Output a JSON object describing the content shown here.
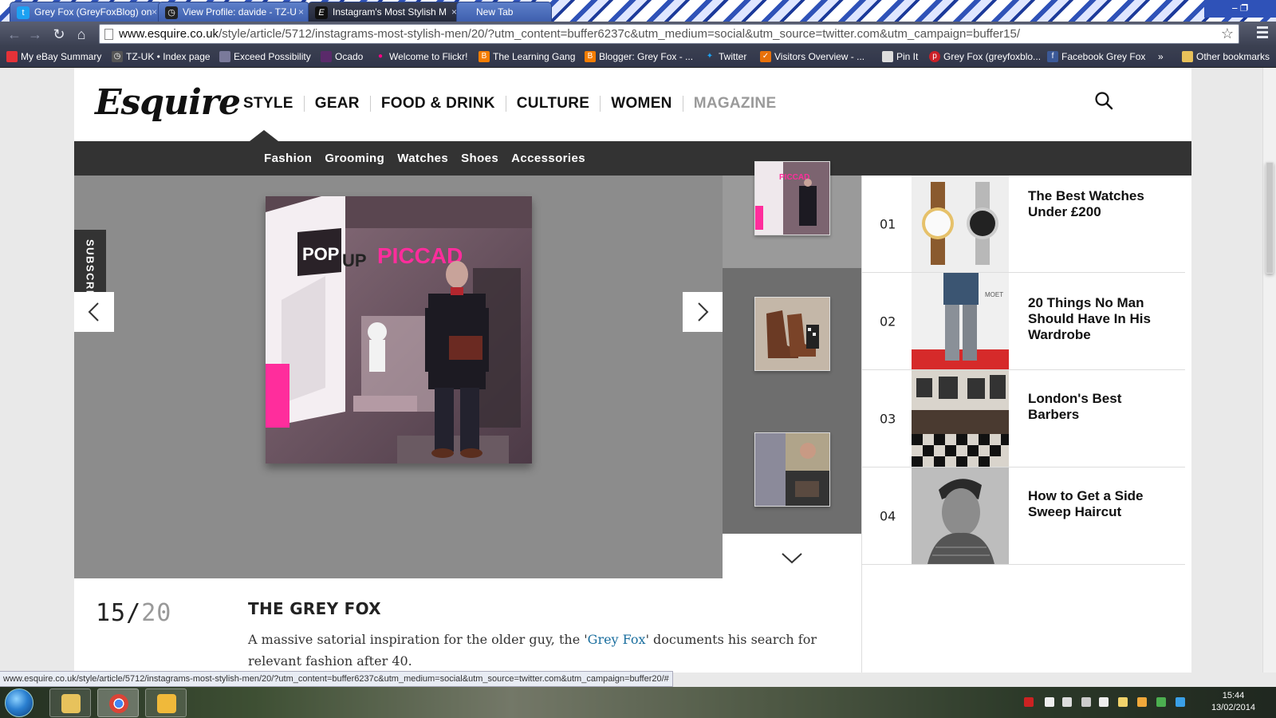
{
  "browser": {
    "tabs": [
      {
        "label": "Grey Fox (GreyFoxBlog) on",
        "icon": "twitter-icon",
        "active": false
      },
      {
        "label": "View Profile: davide - TZ-U",
        "icon": "forum-icon",
        "active": false
      },
      {
        "label": "Instagram's Most Stylish M",
        "icon": "esquire-icon",
        "active": true
      },
      {
        "label": "New Tab",
        "icon": "new-tab-icon",
        "active": false
      }
    ],
    "url_host": "www.esquire.co.uk",
    "url_path": "/style/article/5712/instagrams-most-stylish-men/20/?utm_content=buffer6237c&utm_medium=social&utm_source=twitter.com&utm_campaign=buffer15/",
    "bookmarks": [
      {
        "label": "My eBay Summary",
        "icon": "ebay-icon",
        "color": "#e53238"
      },
      {
        "label": "TZ-UK • Index page",
        "icon": "clock-icon",
        "color": "#555555"
      },
      {
        "label": "Exceed Possibility",
        "icon": "page-icon",
        "color": "#7a7a9a"
      },
      {
        "label": "Ocado",
        "icon": "ocado-icon",
        "color": "#5a2a6a"
      },
      {
        "label": "Welcome to Flickr!",
        "icon": "flickr-icon",
        "color": "#ff0084"
      },
      {
        "label": "The Learning Gang",
        "icon": "blogger-icon",
        "color": "#f57d00"
      },
      {
        "label": "Blogger: Grey Fox - ...",
        "icon": "blogger-icon",
        "color": "#f57d00"
      },
      {
        "label": "Twitter",
        "icon": "twitter-icon",
        "color": "#1da1f2"
      },
      {
        "label": "Visitors Overview - ...",
        "icon": "analytics-icon",
        "color": "#e8710a"
      },
      {
        "label": "Pin It",
        "icon": "page-icon",
        "color": "#dddddd"
      },
      {
        "label": "Grey Fox (greyfoxblo...",
        "icon": "pinterest-icon",
        "color": "#cb2027"
      },
      {
        "label": "Facebook Grey Fox",
        "icon": "facebook-icon",
        "color": "#3b5998"
      }
    ],
    "bookmarks_overflow": "»",
    "other_bookmarks": "Other bookmarks",
    "status_url": "www.esquire.co.uk/style/article/5712/instagrams-most-stylish-men/20/?utm_content=buffer6237c&utm_medium=social&utm_source=twitter.com&utm_campaign=buffer20/#"
  },
  "site": {
    "logo": "Esquire",
    "nav": [
      "STYLE",
      "GEAR",
      "FOOD & DRINK",
      "CULTURE",
      "WOMEN",
      "MAGAZINE"
    ],
    "subnav": [
      "Fashion",
      "Grooming",
      "Watches",
      "Shoes",
      "Accessories"
    ],
    "subscribe": "SUBSCRIBE"
  },
  "gallery": {
    "current": "15",
    "separator": "/",
    "total": "20",
    "title": "THE GREY FOX",
    "desc_before": "A massive satorial inspiration for the older guy, the '",
    "desc_link": "Grey Fox",
    "desc_after": "' documents his search for relevant fashion after 40.",
    "photo_text": {
      "pop": "POP",
      "up": "UP",
      "piccadilly": "PICCAD"
    }
  },
  "sidebar": [
    {
      "num": "01",
      "headline": "The Best Watches Under £200"
    },
    {
      "num": "02",
      "headline": "20 Things No Man Should Have In His Wardrobe"
    },
    {
      "num": "03",
      "headline": "London's Best Barbers"
    },
    {
      "num": "04",
      "headline": "How to Get a Side Sweep Haircut"
    }
  ],
  "taskbar": {
    "time": "15:44",
    "date": "13/02/2014"
  }
}
